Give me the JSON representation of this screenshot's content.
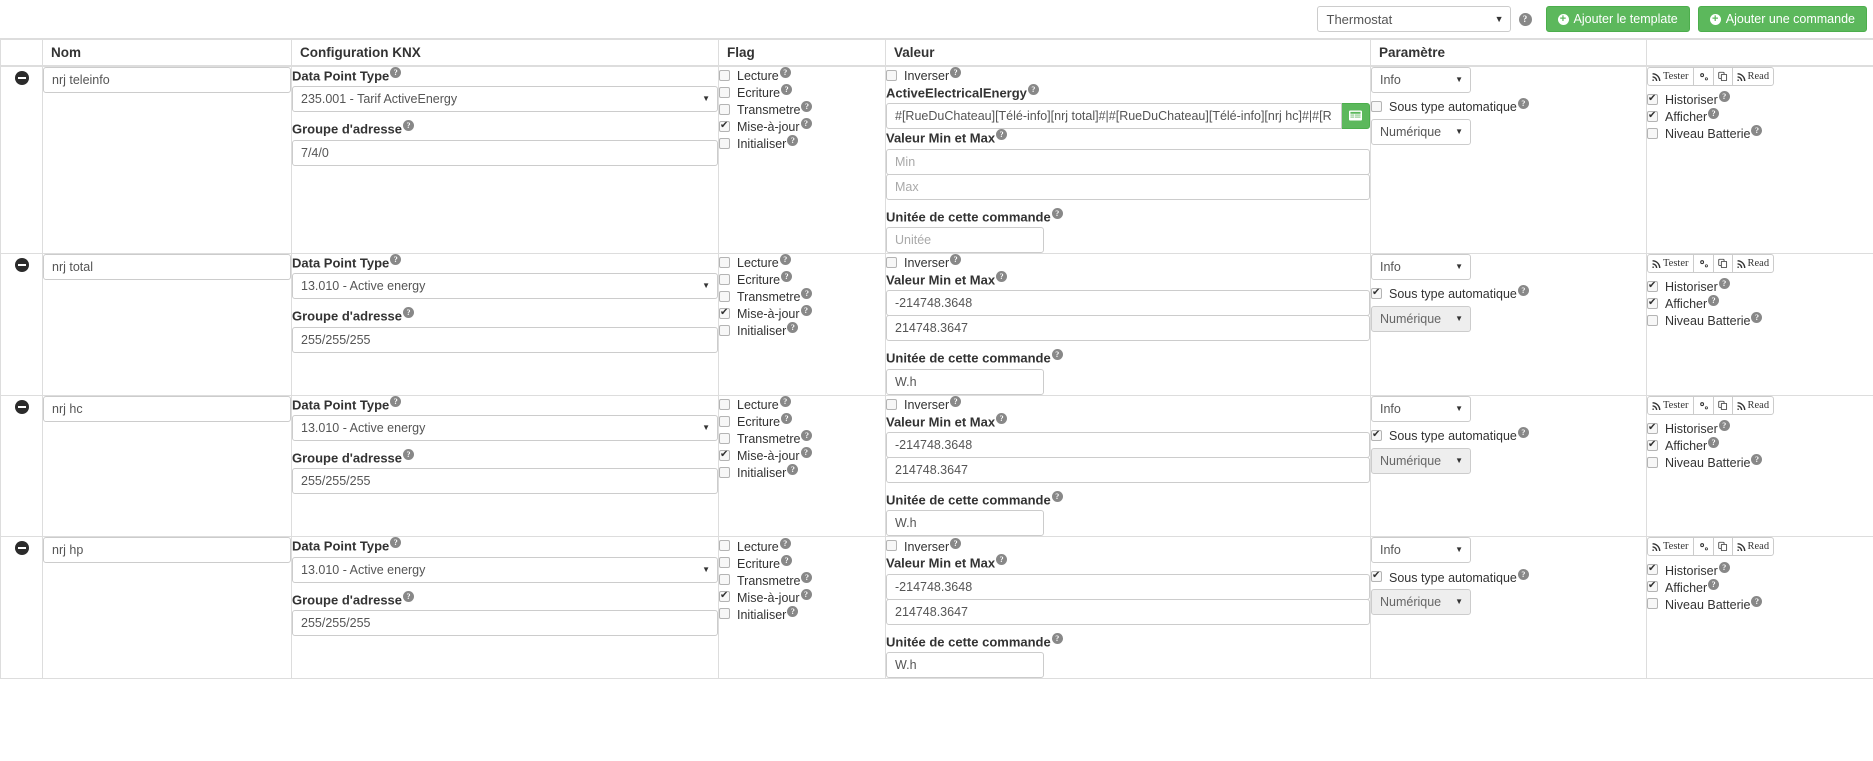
{
  "toolbar": {
    "template_select_value": "Thermostat",
    "help_glyph": "?",
    "add_template_label": "Ajouter le template",
    "add_command_label": "Ajouter une commande",
    "accent_green": "#5cb85c"
  },
  "table": {
    "headers": {
      "handle": "",
      "nom": "Nom",
      "knx": "Configuration KNX",
      "flag": "Flag",
      "valeur": "Valeur",
      "parametre": "Paramètre",
      "actions": ""
    },
    "labels": {
      "data_point_type": "Data Point Type",
      "groupe_adresse": "Groupe d'adresse",
      "inverser": "Inverser",
      "valeur_min_max": "Valeur Min et Max",
      "unitee": "Unitée de cette commande",
      "sous_type_auto": "Sous type automatique",
      "historiser": "Historiser",
      "afficher": "Afficher",
      "niveau_batterie": "Niveau Batterie",
      "flag_lecture": "Lecture",
      "flag_ecriture": "Ecriture",
      "flag_transmetre": "Transmetre",
      "flag_maj": "Mise-à-jour",
      "flag_initialiser": "Initialiser",
      "btn_tester": "Tester",
      "btn_read": "Read"
    },
    "placeholders": {
      "min": "Min",
      "max": "Max",
      "unitee": "Unitée"
    },
    "rows": [
      {
        "nom": "nrj teleinfo",
        "dpt": "235.001 - Tarif ActiveEnergy",
        "groupe": "7/4/0",
        "flags": {
          "lecture": false,
          "ecriture": false,
          "transmetre": false,
          "maj": true,
          "initialiser": false
        },
        "inverser": false,
        "has_expression": true,
        "expression_label": "ActiveElectricalEnergy",
        "expression_value": "#[RueDuChateau][Télé-info][nrj total]#|#[RueDuChateau][Télé-info][nrj hc]#|#[R",
        "min": "",
        "max": "",
        "min_is_placeholder": true,
        "unitee": "",
        "unitee_is_placeholder": true,
        "param_type": "Info",
        "sous_type_auto": false,
        "sous_type": "Numérique",
        "sous_type_disabled": false,
        "historiser": true,
        "afficher": true,
        "niveau_batterie": false
      },
      {
        "nom": "nrj total",
        "dpt": "13.010 - Active energy",
        "groupe": "255/255/255",
        "flags": {
          "lecture": false,
          "ecriture": false,
          "transmetre": false,
          "maj": true,
          "initialiser": false
        },
        "inverser": false,
        "has_expression": false,
        "expression_label": "",
        "expression_value": "",
        "min": "-214748.3648",
        "max": "214748.3647",
        "min_is_placeholder": false,
        "unitee": "W.h",
        "unitee_is_placeholder": false,
        "param_type": "Info",
        "sous_type_auto": true,
        "sous_type": "Numérique",
        "sous_type_disabled": true,
        "historiser": true,
        "afficher": true,
        "niveau_batterie": false
      },
      {
        "nom": "nrj hc",
        "dpt": "13.010 - Active energy",
        "groupe": "255/255/255",
        "flags": {
          "lecture": false,
          "ecriture": false,
          "transmetre": false,
          "maj": true,
          "initialiser": false
        },
        "inverser": false,
        "has_expression": false,
        "expression_label": "",
        "expression_value": "",
        "min": "-214748.3648",
        "max": "214748.3647",
        "min_is_placeholder": false,
        "unitee": "W.h",
        "unitee_is_placeholder": false,
        "param_type": "Info",
        "sous_type_auto": true,
        "sous_type": "Numérique",
        "sous_type_disabled": true,
        "historiser": true,
        "afficher": true,
        "niveau_batterie": false
      },
      {
        "nom": "nrj hp",
        "dpt": "13.010 - Active energy",
        "groupe": "255/255/255",
        "flags": {
          "lecture": false,
          "ecriture": false,
          "transmetre": false,
          "maj": true,
          "initialiser": false
        },
        "inverser": false,
        "has_expression": false,
        "expression_label": "",
        "expression_value": "",
        "min": "-214748.3648",
        "max": "214748.3647",
        "min_is_placeholder": false,
        "unitee": "W.h",
        "unitee_is_placeholder": false,
        "param_type": "Info",
        "sous_type_auto": true,
        "sous_type": "Numérique",
        "sous_type_disabled": true,
        "historiser": true,
        "afficher": true,
        "niveau_batterie": false
      }
    ]
  }
}
